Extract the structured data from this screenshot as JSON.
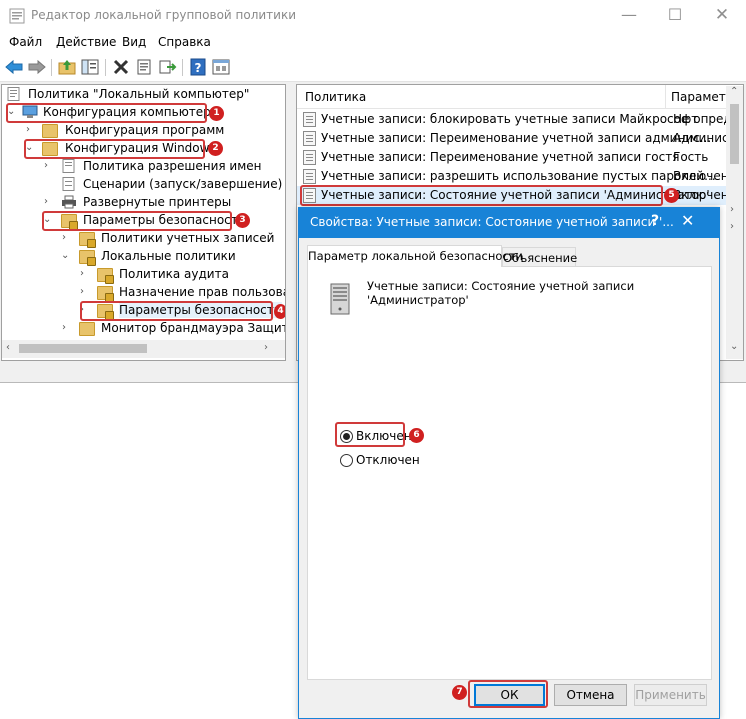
{
  "window": {
    "title": "Редактор локальной групповой политики"
  },
  "menu": [
    "Файл",
    "Действие",
    "Вид",
    "Справка"
  ],
  "tree": {
    "root": "Политика \"Локальный компьютер\"",
    "items": [
      {
        "label": "Конфигурация компьютера",
        "badge": "1"
      },
      {
        "label": "Конфигурация программ"
      },
      {
        "label": "Конфигурация Windows",
        "badge": "2"
      },
      {
        "label": "Политика разрешения имен"
      },
      {
        "label": "Сценарии (запуск/завершение)"
      },
      {
        "label": "Развернутые принтеры"
      },
      {
        "label": "Параметры безопасности",
        "badge": "3"
      },
      {
        "label": "Политики учетных записей"
      },
      {
        "label": "Локальные политики"
      },
      {
        "label": "Политика аудита"
      },
      {
        "label": "Назначение прав пользова"
      },
      {
        "label": "Параметры безопасности",
        "badge": "4"
      },
      {
        "label": "Монитор брандмауэра Защит"
      }
    ]
  },
  "list": {
    "columns": [
      "Политика",
      "Параметр"
    ],
    "rows": [
      {
        "name": "Учетные записи: блокировать учетные записи Майкрософт",
        "value": "Не опред"
      },
      {
        "name": "Учетные записи: Переименование учетной записи админис...",
        "value": "Админист"
      },
      {
        "name": "Учетные записи: Переименование учетной записи гостя",
        "value": "Гость"
      },
      {
        "name": "Учетные записи: разрешить использование пустых паролей...",
        "value": "Включен"
      },
      {
        "name": "Учетные записи: Состояние учетной записи 'Администратор'",
        "value": "Включен",
        "badge": "5"
      }
    ]
  },
  "dialog": {
    "title": "Свойства: Учетные записи: Состояние учетной записи '...",
    "help": "?",
    "tabs": [
      "Параметр локальной безопасности",
      "Объяснение"
    ],
    "description": "Учетные записи: Состояние учетной записи 'Администратор'",
    "options": {
      "enabled": "Включен",
      "disabled": "Отключен",
      "selected": "enabled"
    },
    "enabled_badge": "6",
    "buttons": {
      "ok": "ОК",
      "cancel": "Отмена",
      "apply": "Применить"
    },
    "ok_badge": "7"
  },
  "colors": {
    "accent": "#1883d7",
    "highlight": "#d03a3a",
    "badge": "#d02020"
  },
  "icons": [
    "back-icon",
    "forward-icon",
    "up-folder-icon",
    "show-tree-icon",
    "delete-icon",
    "properties-icon",
    "export-icon",
    "help-icon",
    "console-icon",
    "server-icon"
  ]
}
